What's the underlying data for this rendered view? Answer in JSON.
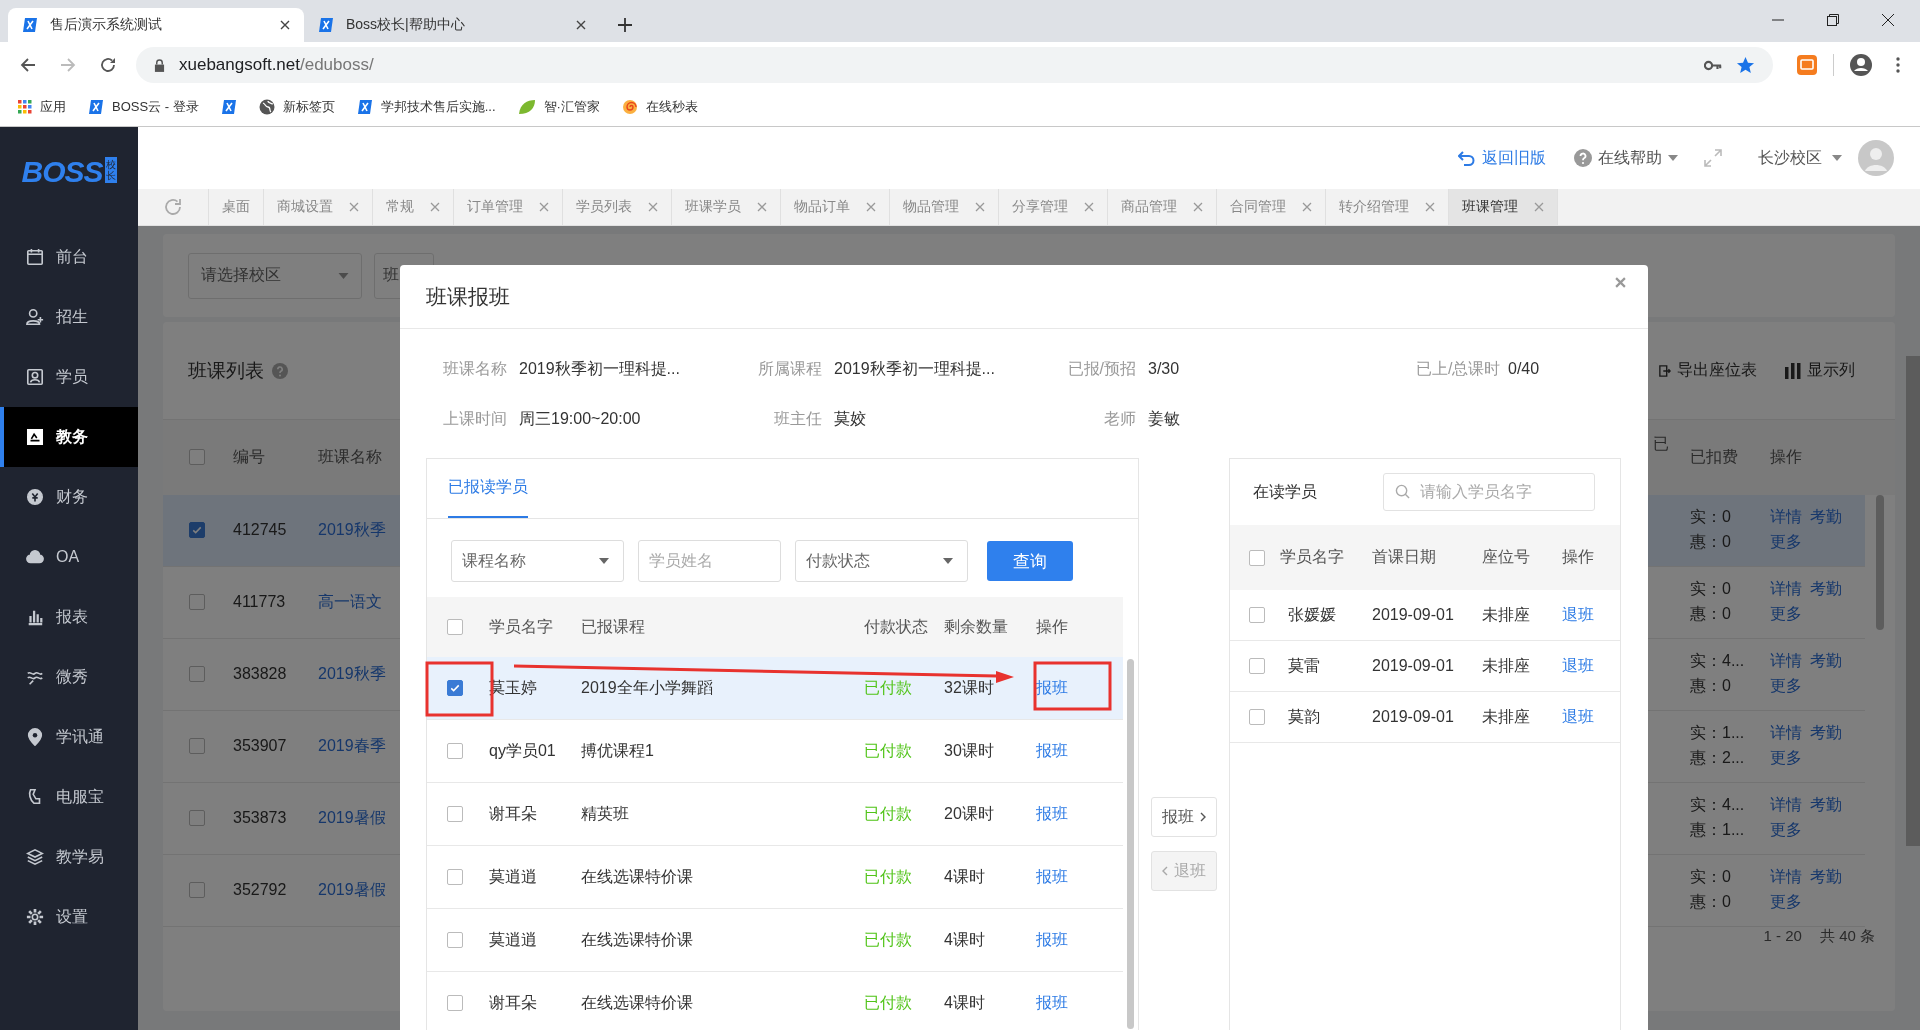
{
  "browser": {
    "tabs": [
      {
        "title": "售后演示系统测试",
        "selected": true
      },
      {
        "title": "Boss校长|帮助中心",
        "selected": false
      }
    ],
    "url_host": "xuebangsoft.net",
    "url_path": "/eduboss/",
    "bookmarks": [
      {
        "kind": "apps",
        "label": "应用"
      },
      {
        "kind": "x",
        "label": "BOSS云 - 登录"
      },
      {
        "kind": "x"
      },
      {
        "kind": "globe",
        "label": "新标签页"
      },
      {
        "kind": "x",
        "label": "学邦技术售后实施..."
      },
      {
        "kind": "leaf",
        "label": "智·汇管家"
      },
      {
        "kind": "spiral",
        "label": "在线秒表"
      }
    ]
  },
  "app_header": {
    "logo": "BOSS",
    "logo_badge": "校长",
    "back_link": "返回旧版",
    "help": "在线帮助",
    "campus": "长沙校区"
  },
  "sidebar": [
    {
      "kind": "calendar",
      "label": "前台",
      "selected": false
    },
    {
      "kind": "user",
      "label": "招生",
      "selected": false
    },
    {
      "kind": "card",
      "label": "学员",
      "selected": false
    },
    {
      "kind": "board",
      "label": "教务",
      "selected": true
    },
    {
      "kind": "coin",
      "label": "财务",
      "selected": false
    },
    {
      "kind": "cloud",
      "label": "OA",
      "selected": false
    },
    {
      "kind": "chart",
      "label": "报表",
      "selected": false
    },
    {
      "kind": "wave",
      "label": "微秀",
      "selected": false
    },
    {
      "kind": "pin",
      "label": "学讯通",
      "selected": false
    },
    {
      "kind": "phone",
      "label": "电服宝",
      "selected": false
    },
    {
      "kind": "layers",
      "label": "教学易",
      "selected": false
    },
    {
      "kind": "gear",
      "label": "设置",
      "selected": false
    }
  ],
  "page_tabs": [
    {
      "label": "桌面",
      "closable": false,
      "selected": false
    },
    {
      "label": "商城设置",
      "closable": true,
      "selected": false
    },
    {
      "label": "常规",
      "closable": true,
      "selected": false
    },
    {
      "label": "订单管理",
      "closable": true,
      "selected": false
    },
    {
      "label": "学员列表",
      "closable": true,
      "selected": false
    },
    {
      "label": "班课学员",
      "closable": true,
      "selected": false
    },
    {
      "label": "物品订单",
      "closable": true,
      "selected": false
    },
    {
      "label": "物品管理",
      "closable": true,
      "selected": false
    },
    {
      "label": "分享管理",
      "closable": true,
      "selected": false
    },
    {
      "label": "商品管理",
      "closable": true,
      "selected": false
    },
    {
      "label": "合同管理",
      "closable": true,
      "selected": false
    },
    {
      "label": "转介绍管理",
      "closable": true,
      "selected": false
    },
    {
      "label": "班课管理",
      "closable": true,
      "selected": true
    }
  ],
  "background": {
    "campus_select": {
      "placeholder": "请选择校区"
    },
    "field_fragment": "班",
    "list_title": "班课列表",
    "toolbar": [
      "导出座位表",
      "显示列"
    ],
    "columns": [
      "编号",
      "班课名称",
      "已",
      "已扣费",
      "操作"
    ],
    "select_all": false,
    "rows": [
      {
        "checked": true,
        "selected": true,
        "id": "412745",
        "name": "2019秋季",
        "actual": "实：0",
        "discount": "惠：0",
        "links": [
          "详情",
          "考勤",
          "更多"
        ]
      },
      {
        "checked": false,
        "selected": false,
        "id": "411773",
        "name": "高一语文",
        "actual": "实：0",
        "discount": "惠：0",
        "links": [
          "详情",
          "考勤",
          "更多"
        ]
      },
      {
        "checked": false,
        "selected": false,
        "id": "383828",
        "name": "2019秋季",
        "actual": "实：4...",
        "discount": "惠：0",
        "links": [
          "详情",
          "考勤",
          "更多"
        ]
      },
      {
        "checked": false,
        "selected": false,
        "id": "353907",
        "name": "2019春季",
        "actual": "实：1...",
        "discount": "惠：2...",
        "links": [
          "详情",
          "考勤",
          "更多"
        ]
      },
      {
        "checked": false,
        "selected": false,
        "id": "353873",
        "name": "2019暑假",
        "actual": "实：4...",
        "discount": "惠：1...",
        "links": [
          "详情",
          "考勤",
          "更多"
        ]
      },
      {
        "checked": false,
        "selected": false,
        "id": "352792",
        "name": "2019暑假",
        "actual": "实：0",
        "discount": "惠：0",
        "links": [
          "详情",
          "考勤",
          "更多"
        ]
      }
    ],
    "pagination": "1 - 20",
    "total": "共 40 条"
  },
  "dialog": {
    "title": "班课报班",
    "info": [
      {
        "label": "班课名称",
        "value": "2019秋季初一理科提..."
      },
      {
        "label": "所属课程",
        "value": "2019秋季初一理科提..."
      },
      {
        "label": "已报/预招",
        "value": "3/30"
      },
      {
        "label": "已上/总课时",
        "value": "0/40"
      },
      {
        "label": "上课时间",
        "value": "周三19:00~20:00"
      },
      {
        "label": "班主任",
        "value": "莫姣"
      },
      {
        "label": "老师",
        "value": "姜敏"
      }
    ],
    "enrolled": {
      "tab": {
        "label": "已报读学员",
        "selected": true
      },
      "filters": [
        {
          "kind": "select",
          "placeholder": "课程名称"
        },
        {
          "kind": "input",
          "placeholder": "学员姓名"
        },
        {
          "kind": "select",
          "placeholder": "付款状态"
        }
      ],
      "search_button": "查询",
      "columns": [
        "学员名字",
        "已报课程",
        "付款状态",
        "剩余数量",
        "操作"
      ],
      "select_all": false,
      "rows": [
        {
          "checked": true,
          "selected": true,
          "name": "莫玉婷",
          "course": "2019全年小学舞蹈",
          "status": "已付款",
          "remaining": "32课时",
          "action": "报班"
        },
        {
          "checked": false,
          "selected": false,
          "name": "qy学员01",
          "course": "搏优课程1",
          "status": "已付款",
          "remaining": "30课时",
          "action": "报班"
        },
        {
          "checked": false,
          "selected": false,
          "name": "谢耳朵",
          "course": "精英班",
          "status": "已付款",
          "remaining": "20课时",
          "action": "报班"
        },
        {
          "checked": false,
          "selected": false,
          "name": "莫逍逍",
          "course": "在线选课特价课",
          "status": "已付款",
          "remaining": "4课时",
          "action": "报班"
        },
        {
          "checked": false,
          "selected": false,
          "name": "莫逍逍",
          "course": "在线选课特价课",
          "status": "已付款",
          "remaining": "4课时",
          "action": "报班"
        },
        {
          "checked": false,
          "selected": false,
          "name": "谢耳朵",
          "course": "在线选课特价课",
          "status": "已付款",
          "remaining": "4课时",
          "action": "报班"
        }
      ]
    },
    "transfer": {
      "add": {
        "label": "报班",
        "disabled": false
      },
      "remove": {
        "label": "退班",
        "disabled": true
      }
    },
    "current": {
      "title": "在读学员",
      "search": {
        "placeholder": "请输入学员名字"
      },
      "columns": [
        "学员名字",
        "首课日期",
        "座位号",
        "操作"
      ],
      "select_all": false,
      "rows": [
        {
          "checked": false,
          "name": "张媛媛",
          "date": "2019-09-01",
          "seat": "未排座",
          "action": "退班"
        },
        {
          "checked": false,
          "name": "莫雷",
          "date": "2019-09-01",
          "seat": "未排座",
          "action": "退班"
        },
        {
          "checked": false,
          "name": "莫韵",
          "date": "2019-09-01",
          "seat": "未排座",
          "action": "退班"
        }
      ]
    }
  }
}
